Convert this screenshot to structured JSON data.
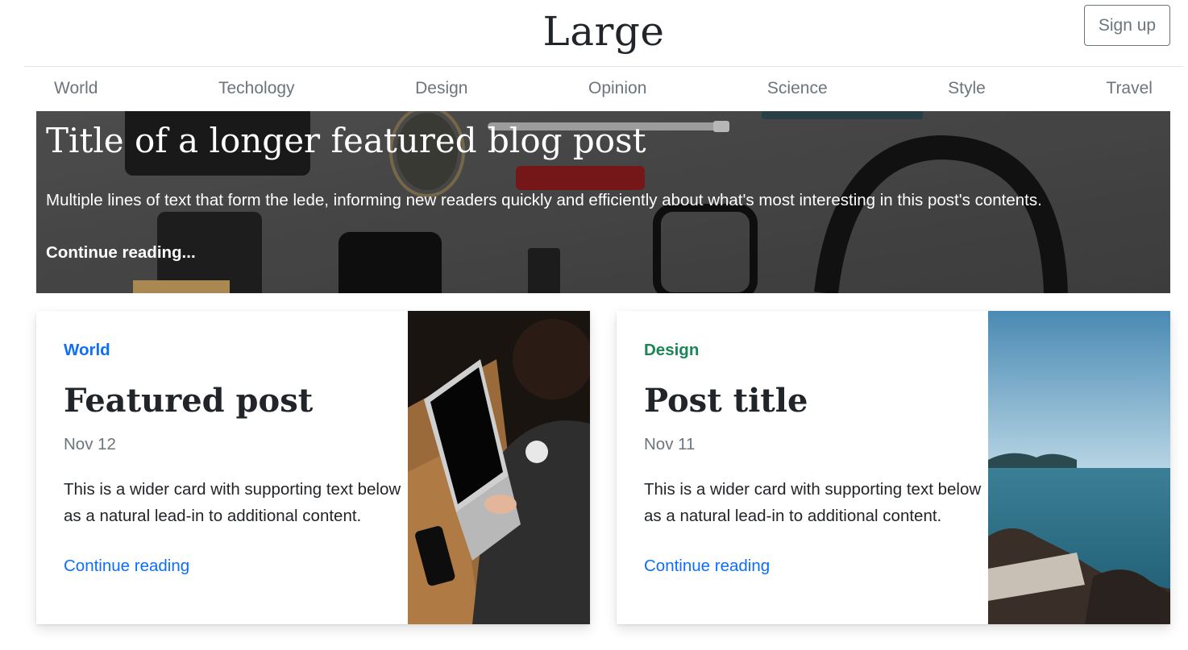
{
  "header": {
    "brand": "Large",
    "signup_label": "Sign up"
  },
  "nav": {
    "items": [
      "World",
      "Techology",
      "Design",
      "Opinion",
      "Science",
      "Style",
      "Travel"
    ]
  },
  "hero": {
    "title": "Title of a longer featured blog post",
    "lede": "Multiple lines of text that form the lede, informing new readers quickly and efficiently about what's most interesting in this post's contents.",
    "link": "Continue reading..."
  },
  "cards": [
    {
      "category": "World",
      "category_color": "#0d6efd",
      "title": "Featured post",
      "date": "Nov 12",
      "text": "This is a wider card with supporting text below as a natural lead-in to additional content.",
      "link": "Continue reading"
    },
    {
      "category": "Design",
      "category_color": "#198754",
      "title": "Post title",
      "date": "Nov 11",
      "text": "This is a wider card with supporting text below as a natural lead-in to additional content.",
      "link": "Continue reading"
    }
  ]
}
